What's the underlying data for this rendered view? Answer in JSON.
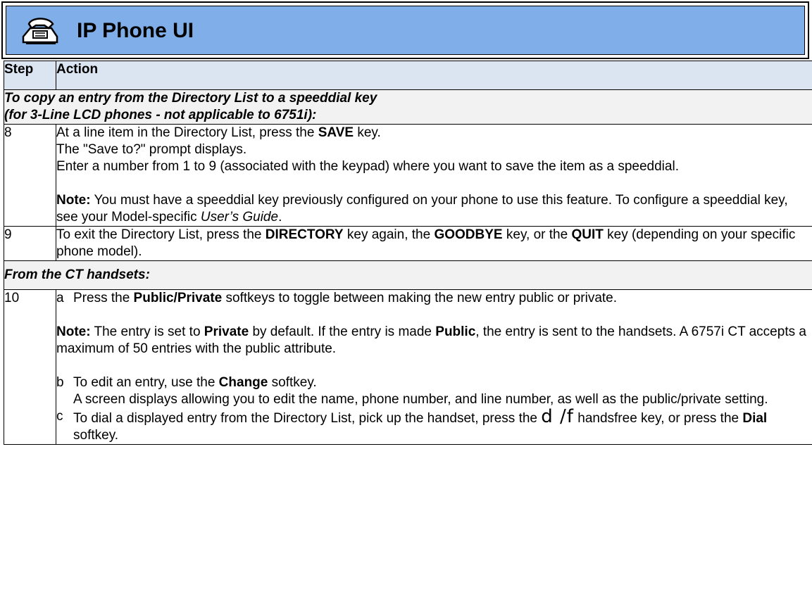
{
  "header": {
    "title": "IP Phone UI",
    "icon": "phone-icon"
  },
  "table": {
    "col_step": "Step",
    "col_action": "Action",
    "section1": {
      "line1": "To copy an entry from the Directory List to a speeddial key",
      "line2": "(for 3-Line LCD phones - not applicable to 6751i):"
    },
    "row8": {
      "step": "8",
      "p1_a": "At a line item in the Directory List, press the ",
      "p1_b": "SAVE",
      "p1_c": " key.",
      "p2": "The \"Save to?\" prompt displays.",
      "p3": "Enter a number from 1 to 9 (associated with the keypad) where you want to save the item as a speeddial.",
      "note_label": "Note:",
      "note_a": " You must have a speeddial key previously configured on your phone to use this feature. To configure a speeddial key, see your Model-specific ",
      "note_b": "User’s Guide",
      "note_c": "."
    },
    "row9": {
      "step": "9",
      "t1": "To exit the Directory List, press the ",
      "k1": "DIRECTORY",
      "t2": " key again, the ",
      "k2": "GOODBYE",
      "t3": " key, or the ",
      "k3": "QUIT",
      "t4": " key (depending on your specific phone model)."
    },
    "section2": {
      "line1": "From the CT handsets:"
    },
    "row10": {
      "step": "10",
      "a_letter": "a",
      "a_t1": "Press the ",
      "a_k1": "Public/Private",
      "a_t2": " softkeys to toggle between making the new entry public or private.",
      "note_label": "Note:",
      "note_t1": " The entry is set to ",
      "note_k1": "Private",
      "note_t2": " by default. If the entry is made ",
      "note_k2": "Public",
      "note_t3": ", the entry is sent to the handsets. A 6757i CT accepts a maximum of 50 entries with the public attribute.",
      "b_letter": "b",
      "b_t1": "To edit an entry, use the ",
      "b_k1": "Change",
      "b_t2": " softkey.",
      "b_line2": "A screen displays allowing you to edit the name, phone number, and line number, as well as the public/private setting.",
      "c_letter": "c",
      "c_t1": "To dial a displayed entry from the Directory List, pick up the handset, press the ",
      "c_glyph": "d /f",
      "c_t2": " handsfree key, or press the ",
      "c_k1": "Dial",
      "c_t3": " softkey."
    }
  }
}
